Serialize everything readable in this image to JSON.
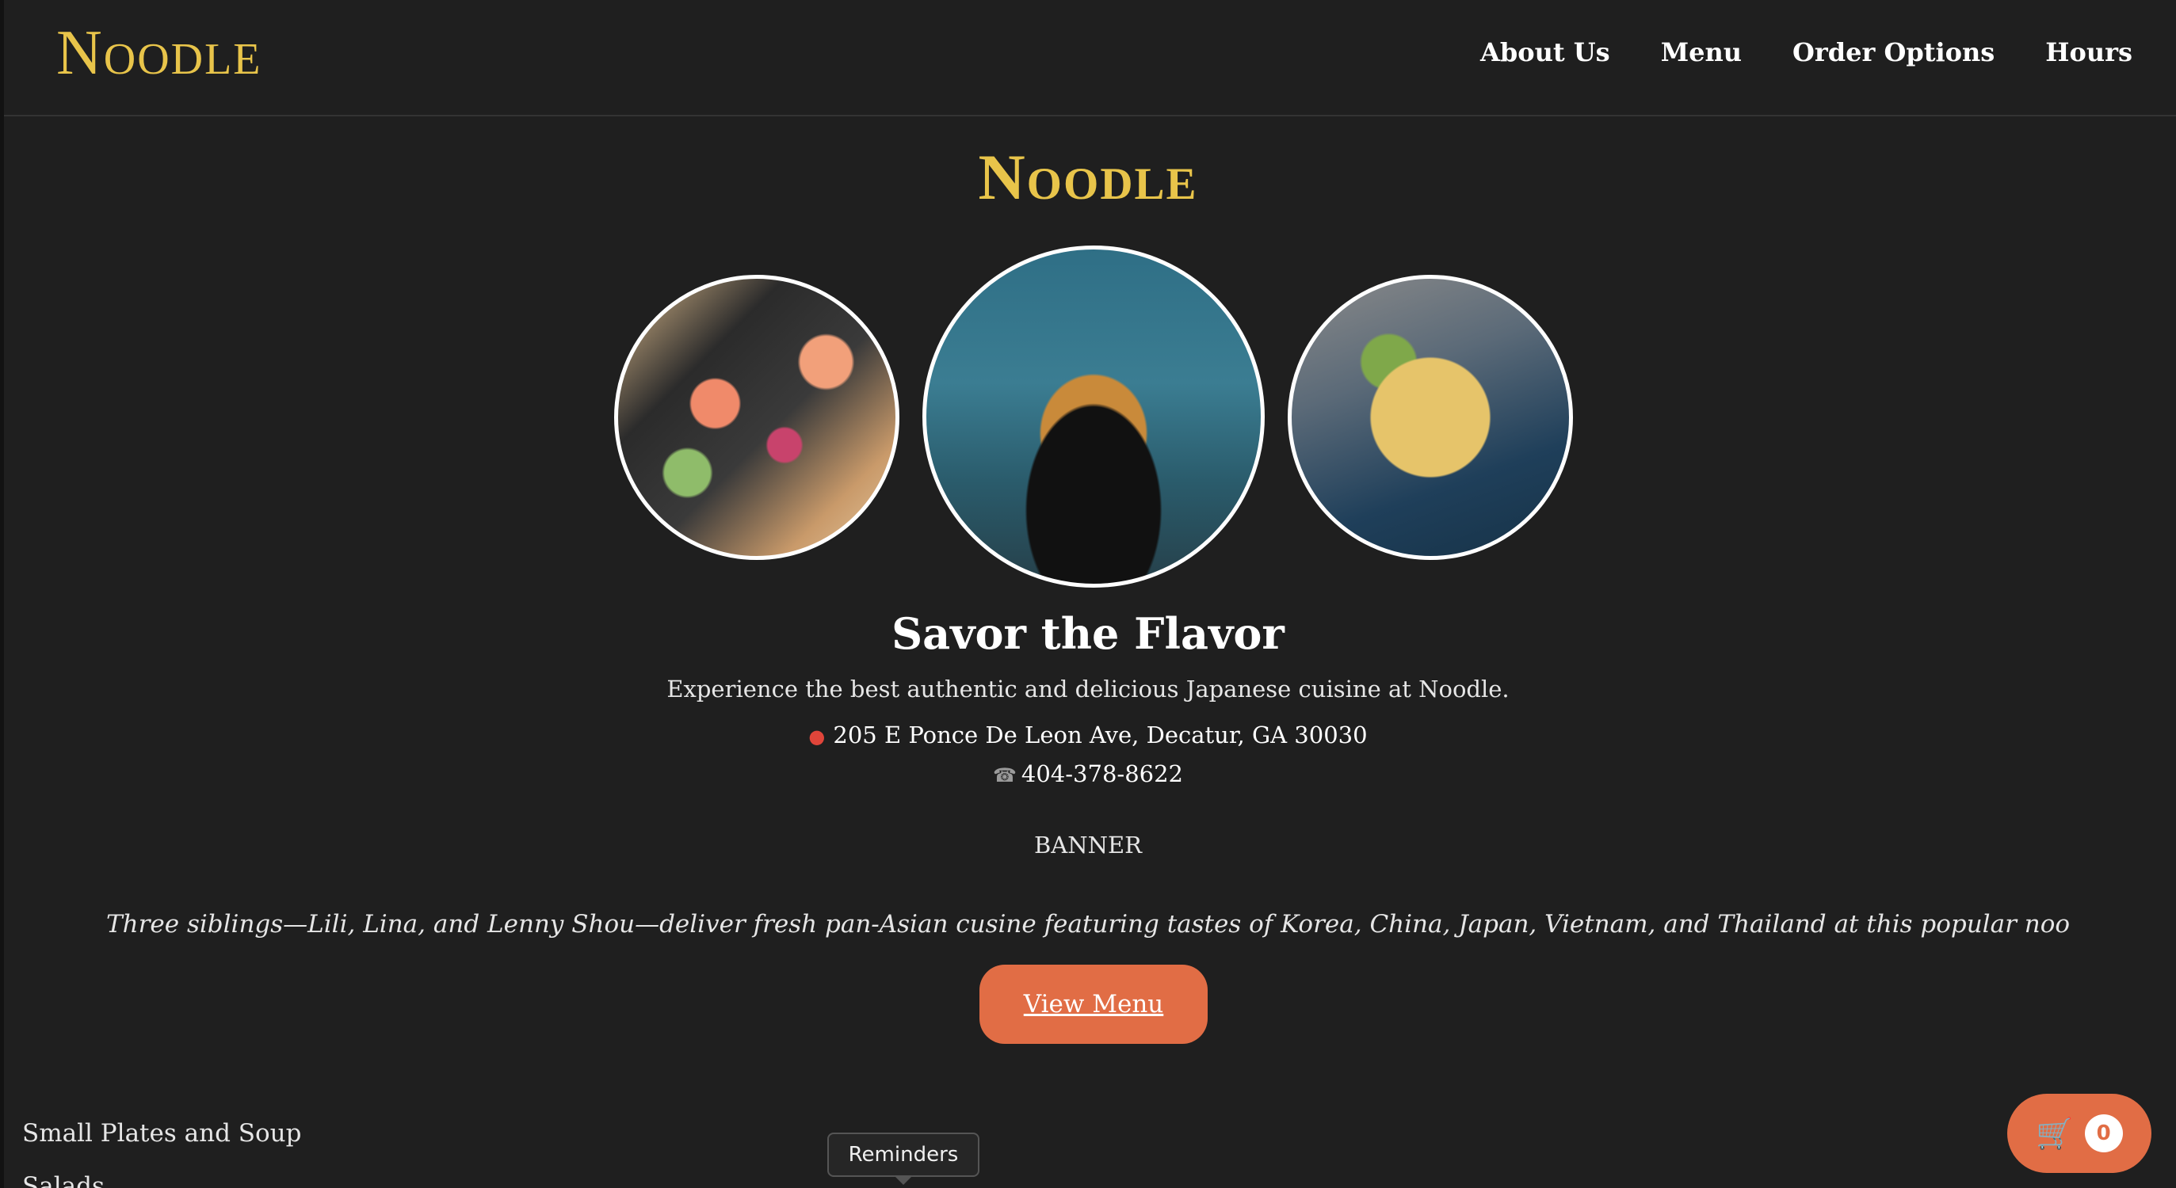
{
  "header": {
    "brand": "Noodle",
    "nav": [
      {
        "label": "About Us"
      },
      {
        "label": "Menu"
      },
      {
        "label": "Order Options"
      },
      {
        "label": "Hours"
      }
    ]
  },
  "hero": {
    "title": "Noodle",
    "tagline": "Savor the Flavor",
    "description": "Experience the best authentic and delicious Japanese cuisine at Noodle.",
    "address": "205 E Ponce De Leon Ave, Decatur, GA 30030",
    "phone": "404-378-8622",
    "banner_label": "BANNER",
    "ticker": "Three siblings—Lili, Lina, and Lenny Shou—deliver fresh pan-Asian cusine featuring tastes of Korea, China, Japan, Vietnam, and Thailand at this popular noo",
    "cta_label": "View Menu"
  },
  "icons": {
    "address": "map-pin-icon",
    "phone": "phone-icon",
    "cart": "shopping-cart-icon"
  },
  "menu_categories": [
    {
      "label": "Small Plates and Soup"
    },
    {
      "label": "Salads"
    }
  ],
  "tooltip": {
    "label": "Reminders"
  },
  "cart": {
    "count": "0"
  },
  "colors": {
    "background": "#1f1f1f",
    "brand_gold": "#e8c44a",
    "accent_orange": "#e16d45"
  }
}
